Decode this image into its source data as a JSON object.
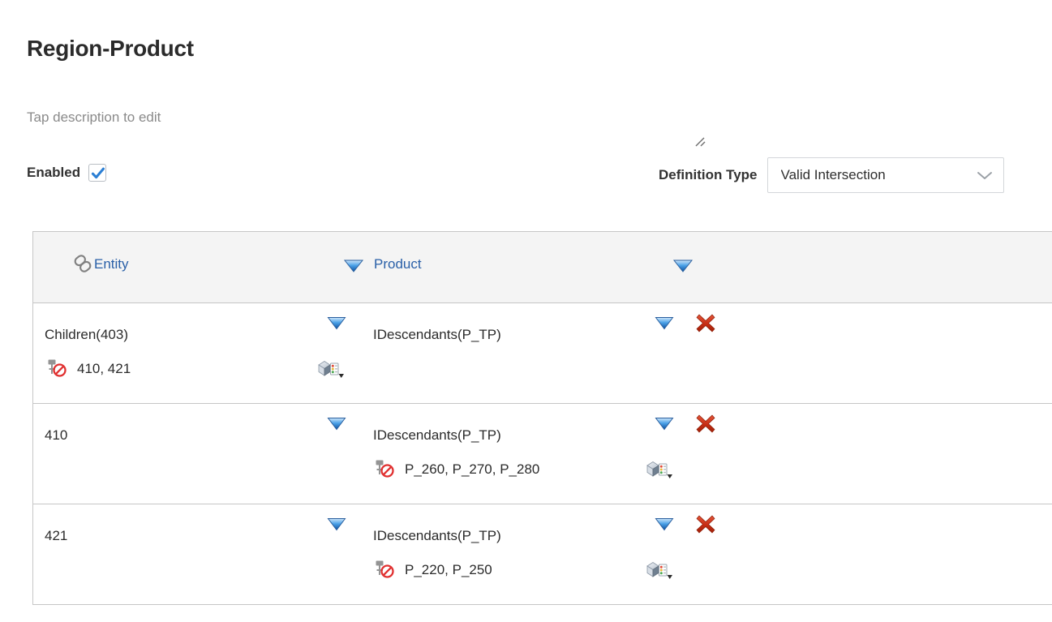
{
  "page": {
    "title": "Region-Product",
    "description": "Tap description to edit"
  },
  "controls": {
    "enabled_label": "Enabled",
    "enabled_checked": true,
    "definition_type_label": "Definition Type",
    "definition_type_value": "Valid Intersection",
    "resize_grip_icon": "resize-grip-icon",
    "checkbox_icon": "check-icon",
    "select_arrow_icon": "chevron-down-icon"
  },
  "colors": {
    "header_link": "#2a60a8",
    "accent_blue": "#2b7fd4",
    "delete_red": "#c9381a",
    "header_bg": "#f4f4f4",
    "border": "#c6c6c6"
  },
  "table": {
    "link_icon": "chain-link-icon",
    "sort_icon": "sort-triangle-icon",
    "columns": [
      {
        "label": "Entity",
        "sort_icon": "sort-triangle-icon"
      },
      {
        "label": "Product",
        "sort_icon": "sort-triangle-icon"
      }
    ],
    "rows": [
      {
        "entity": "Children(403)",
        "entity_exclusions": "410, 421",
        "entity_has_exclusion": true,
        "entity_cube_icon": "cube-dimension-icon",
        "product": "IDescendants(P_TP)",
        "product_exclusions": "",
        "product_has_exclusion": false,
        "product_cube_icon": "",
        "delete_icon": "delete-x-icon",
        "exclusion_icon": "excluded-member-icon"
      },
      {
        "entity": "410",
        "entity_exclusions": "",
        "entity_has_exclusion": false,
        "entity_cube_icon": "",
        "product": "IDescendants(P_TP)",
        "product_exclusions": "P_260, P_270, P_280",
        "product_has_exclusion": true,
        "product_cube_icon": "cube-dimension-icon",
        "delete_icon": "delete-x-icon",
        "exclusion_icon": "excluded-member-icon"
      },
      {
        "entity": "421",
        "entity_exclusions": "",
        "entity_has_exclusion": false,
        "entity_cube_icon": "",
        "product": "IDescendants(P_TP)",
        "product_exclusions": "P_220, P_250",
        "product_has_exclusion": true,
        "product_cube_icon": "cube-dimension-icon",
        "delete_icon": "delete-x-icon",
        "exclusion_icon": "excluded-member-icon"
      }
    ]
  }
}
